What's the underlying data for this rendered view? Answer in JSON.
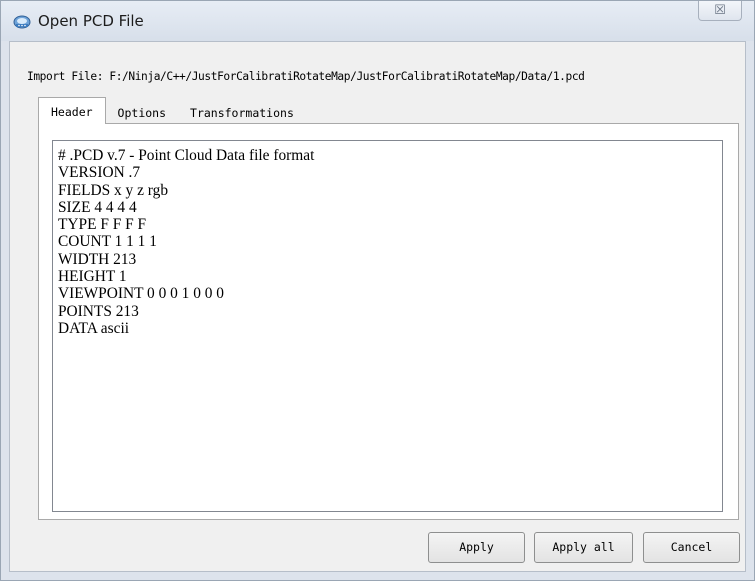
{
  "window": {
    "title": "Open PCD File",
    "close_glyph": "☒",
    "app_icon": "pcd-file-icon"
  },
  "import": {
    "label": "Import File: F:/Ninja/C++/JustForCalibratiRotateMap/JustForCalibratiRotateMap/Data/1.pcd"
  },
  "tabs": [
    {
      "label": "Header",
      "active": true
    },
    {
      "label": "Options",
      "active": false
    },
    {
      "label": "Transformations",
      "active": false
    }
  ],
  "header": {
    "text": "# .PCD v.7 - Point Cloud Data file format\nVERSION .7\nFIELDS x y z rgb\nSIZE 4 4 4 4\nTYPE F F F F\nCOUNT 1 1 1 1\nWIDTH 213\nHEIGHT 1\nVIEWPOINT 0 0 0 1 0 0 0\nPOINTS 213\nDATA ascii"
  },
  "buttons": {
    "apply": "Apply",
    "apply_all": "Apply all",
    "cancel": "Cancel"
  }
}
